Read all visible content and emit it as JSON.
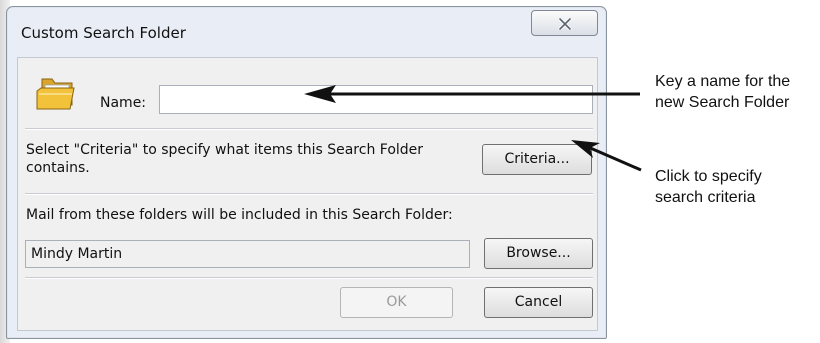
{
  "dialog": {
    "title": "Custom Search Folder",
    "close_glyph": "✕",
    "name_label": "Name:",
    "name_value": "",
    "criteria_text": "Select \"Criteria\" to specify what items this Search Folder contains.",
    "criteria_button": "Criteria...",
    "folders_label": "Mail from these folders will be included in this Search Folder:",
    "folder_value": "Mindy Martin",
    "browse_button": "Browse...",
    "ok_button": "OK",
    "cancel_button": "Cancel"
  },
  "callouts": {
    "name_line1": "Key a name for the",
    "name_line2": "new Search Folder",
    "criteria_line1": "Click to specify",
    "criteria_line2": "search criteria"
  },
  "icons": {
    "folder": "search-folder-icon",
    "close": "close-icon"
  },
  "colors": {
    "dialog_frame": "#e9eef6",
    "client_area": "#f0f0f0",
    "folder_yellow": "#f2c23a"
  }
}
